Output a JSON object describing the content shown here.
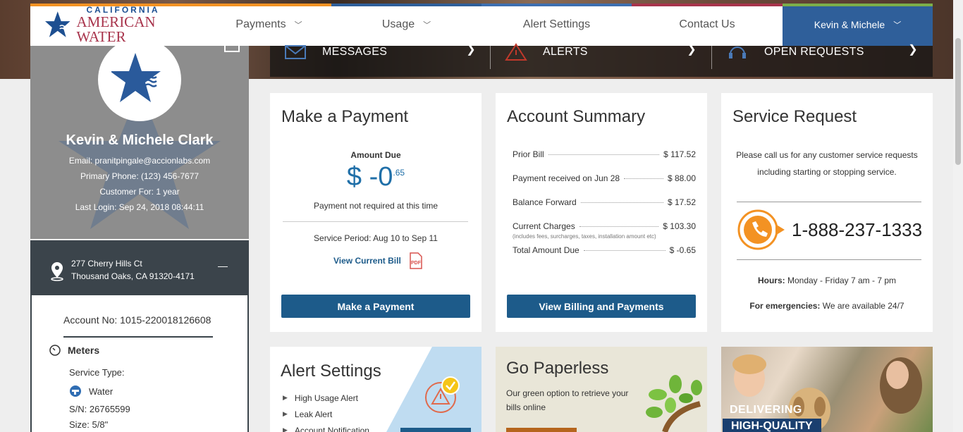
{
  "brand": {
    "logo_small": "CALIFORNIA",
    "logo_big": "AMERICAN WATER",
    "colors": {
      "primary_blue": "#2f5f9a",
      "button_blue": "#1d5b8a",
      "accent_red": "#a8344c",
      "orange": "#f39223"
    }
  },
  "nav": {
    "items": [
      {
        "label": "Payments",
        "has_dropdown": true
      },
      {
        "label": "Usage",
        "has_dropdown": true
      },
      {
        "label": "Alert Settings",
        "has_dropdown": false
      },
      {
        "label": "Contact Us",
        "has_dropdown": false
      }
    ],
    "user_menu": "Kevin & Michele"
  },
  "quickbar": {
    "messages": "MESSAGES",
    "alerts": "ALERTS",
    "open_requests": "OPEN REQUESTS"
  },
  "profile": {
    "name": "Kevin & Michele Clark",
    "email": "Email: pranitpingale@accionlabs.com",
    "phone": "Primary Phone: (123) 456-7677",
    "customer_for": "Customer For: 1 year",
    "last_login": "Last Login: Sep 24, 2018 08:44:11"
  },
  "address": {
    "line1": "277 Cherry Hills Ct",
    "line2": "Thousand Oaks, CA 91320-4171",
    "collapse": "—"
  },
  "account": {
    "account_no": "Account No: 1015-220018126608",
    "meters_label": "Meters",
    "service_type_label": "Service Type:",
    "service_type": "Water",
    "serial": "S/N: 26765599",
    "size": "Size: 5/8\""
  },
  "payment_card": {
    "title": "Make a Payment",
    "amount_label": "Amount Due",
    "amount_main": "$ -0",
    "amount_cents": ".65",
    "note": "Payment not required at this time",
    "service_period": "Service Period: Aug 10 to Sep 11",
    "view_bill": "View Current Bill",
    "pdf": "PDF",
    "button": "Make a Payment"
  },
  "summary_card": {
    "title": "Account Summary",
    "rows": [
      {
        "label": "Prior Bill",
        "value": "$ 117.52"
      },
      {
        "label": "Payment received on Jun 28",
        "value": "$ 88.00"
      },
      {
        "label": "Balance Forward",
        "value": "$ 17.52"
      },
      {
        "label": "Current Charges",
        "value": "$ 103.30"
      },
      {
        "label": "Total Amount Due",
        "value": "$ -0.65"
      }
    ],
    "charges_note": "(includes fees, surcharges, taxes, installation amount etc)",
    "button": "View Billing and Payments"
  },
  "service_card": {
    "title": "Service Request",
    "text1": "Please call us for any customer service requests",
    "text2": "including starting or stopping service.",
    "phone": "1-888-237-1333",
    "hours_label": "Hours:",
    "hours": " Monday - Friday 7 am - 7 pm",
    "emerg_label": "For emergencies:",
    "emerg": " We are available 24/7"
  },
  "alert_card": {
    "title": "Alert Settings",
    "items": [
      "High Usage Alert",
      "Leak Alert",
      "Account Notification"
    ]
  },
  "paperless_card": {
    "title": "Go Paperless",
    "text": "Our green option to retrieve your bills online"
  },
  "quality_card": {
    "line1": "DELIVERING",
    "line2": "HIGH-QUALITY"
  }
}
